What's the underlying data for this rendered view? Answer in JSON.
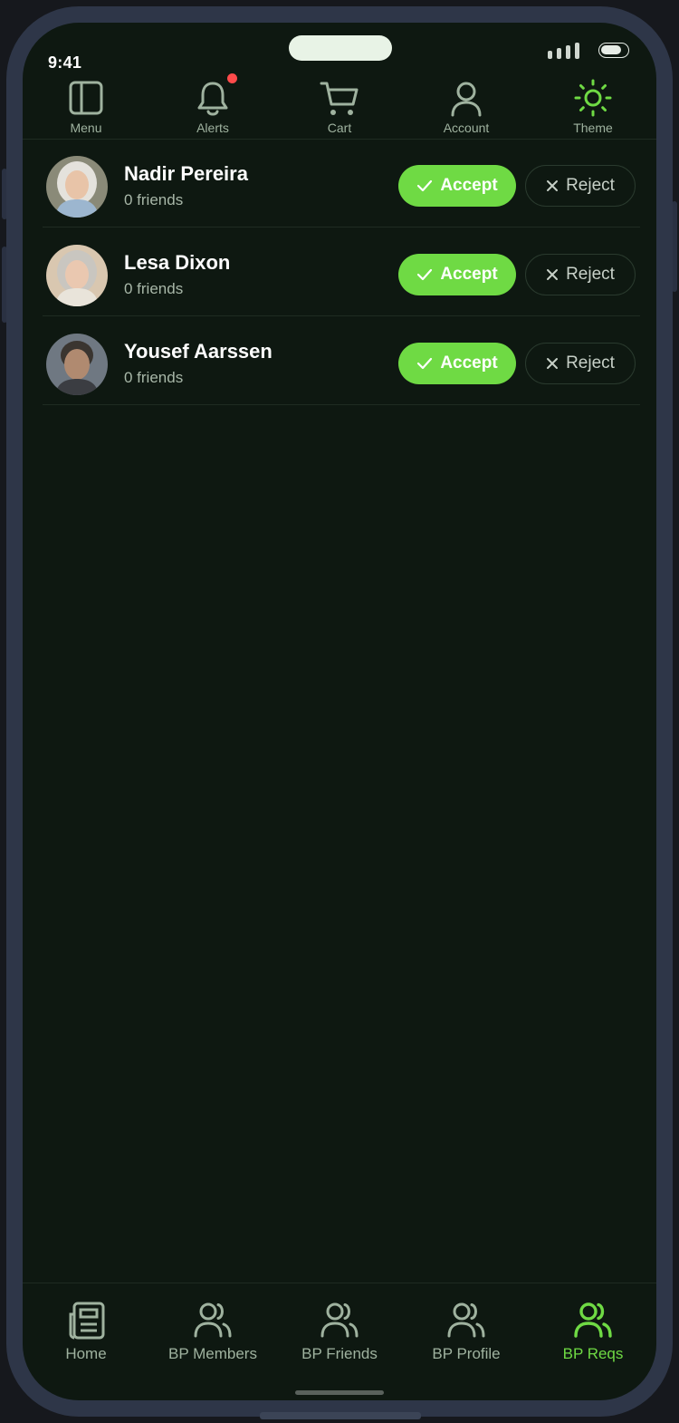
{
  "status_bar": {
    "time": "9:41"
  },
  "top_nav": [
    {
      "label": "Menu",
      "icon": "sidebar-panel-icon"
    },
    {
      "label": "Alerts",
      "icon": "bell-icon",
      "has_badge": true
    },
    {
      "label": "Cart",
      "icon": "cart-icon"
    },
    {
      "label": "Account",
      "icon": "user-icon"
    },
    {
      "label": "Theme",
      "icon": "sun-icon",
      "active": true
    }
  ],
  "requests": [
    {
      "name": "Nadir Pereira",
      "friends": "0 friends",
      "accept_label": "Accept",
      "reject_label": "Reject"
    },
    {
      "name": "Lesa Dixon",
      "friends": "0 friends",
      "accept_label": "Accept",
      "reject_label": "Reject"
    },
    {
      "name": "Yousef Aarssen",
      "friends": "0 friends",
      "accept_label": "Accept",
      "reject_label": "Reject"
    }
  ],
  "bottom_nav": [
    {
      "label": "Home",
      "icon": "newspaper-icon"
    },
    {
      "label": "BP Members",
      "icon": "users-icon"
    },
    {
      "label": "BP Friends",
      "icon": "users-icon"
    },
    {
      "label": "BP Profile",
      "icon": "users-icon"
    },
    {
      "label": "BP Reqs",
      "icon": "users-icon",
      "active": true
    }
  ],
  "colors": {
    "accent": "#6fda44",
    "background": "#0e1811",
    "frame": "#2e3648",
    "badge": "#ff4b4b",
    "muted_text": "#9fb29f"
  }
}
